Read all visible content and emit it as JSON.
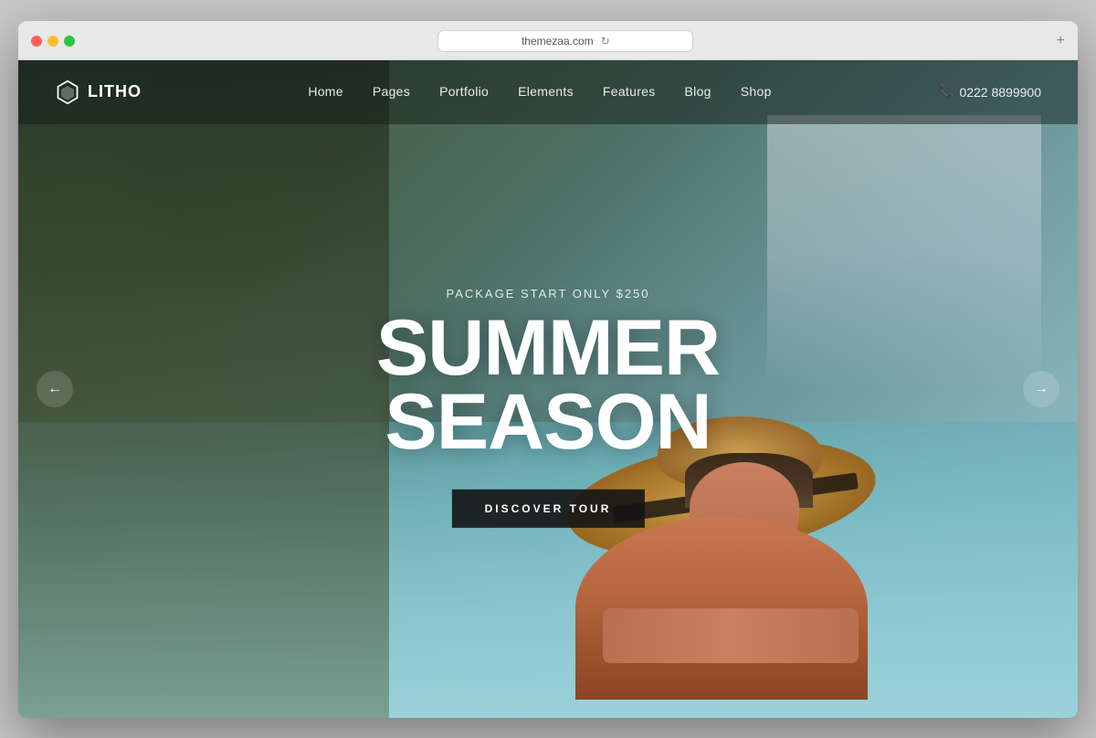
{
  "browser": {
    "url": "themezaa.com",
    "new_tab_label": "+"
  },
  "logo": {
    "text": "LITHO"
  },
  "nav": {
    "items": [
      {
        "label": "Home"
      },
      {
        "label": "Pages"
      },
      {
        "label": "Portfolio"
      },
      {
        "label": "Elements"
      },
      {
        "label": "Features"
      },
      {
        "label": "Blog"
      },
      {
        "label": "Shop"
      }
    ],
    "phone": "0222 8899900"
  },
  "hero": {
    "subtitle": "PACKAGE START ONLY $250",
    "title_line1": "SUMMER",
    "title_line2": "SEASON",
    "cta_label": "DISCOVER TOUR"
  },
  "slider": {
    "prev_arrow": "←",
    "next_arrow": "→"
  }
}
